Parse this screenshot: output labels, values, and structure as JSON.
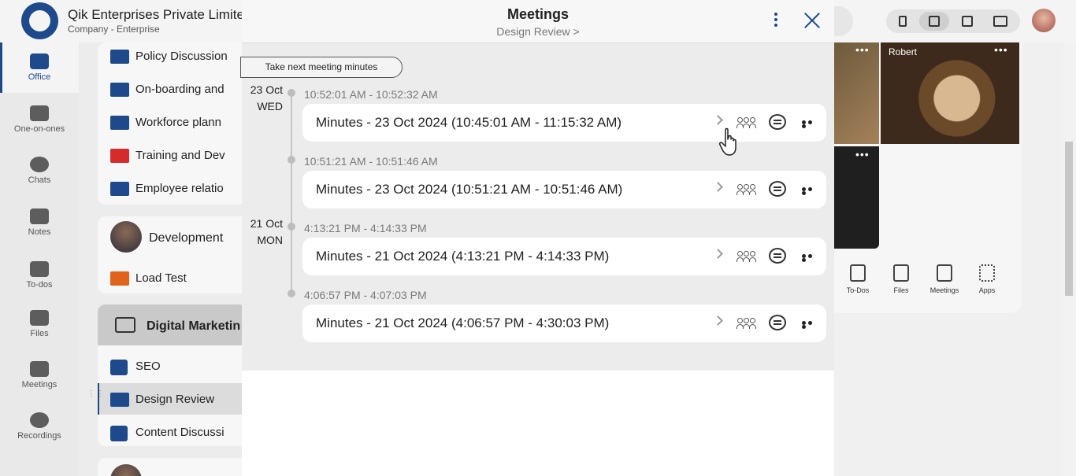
{
  "app": {
    "company_name": "Qik Enterprises Private Limited",
    "company_type": "Company - Enterprise"
  },
  "nav": {
    "items": [
      {
        "label": "Office",
        "icon": "briefcase-icon",
        "active": true
      },
      {
        "label": "One-on-ones",
        "icon": "people-icon"
      },
      {
        "label": "Chats",
        "icon": "chat-icon"
      },
      {
        "label": "Notes",
        "icon": "notes-icon"
      },
      {
        "label": "To-dos",
        "icon": "todo-icon"
      },
      {
        "label": "Files",
        "icon": "files-icon"
      },
      {
        "label": "Meetings",
        "icon": "meetings-icon"
      },
      {
        "label": "Recordings",
        "icon": "recordings-icon"
      }
    ]
  },
  "channels": {
    "items_top": [
      {
        "label": "Policy Discussion",
        "color": "#1e4a8c"
      },
      {
        "label": "On-boarding and",
        "color": "#1e4a8c"
      },
      {
        "label": "Workforce plann",
        "color": "#1e4a8c"
      },
      {
        "label": "Training and Dev",
        "color": "#d62b2b"
      },
      {
        "label": "Employee relatio",
        "color": "#1e4a8c"
      }
    ],
    "development": {
      "title": "Development",
      "items": [
        {
          "label": "Load Test",
          "color": "#e0621c"
        }
      ]
    },
    "digital_marketing": {
      "title": "Digital Marketin",
      "items": [
        {
          "label": "SEO",
          "icon": "location-pin-icon"
        },
        {
          "label": "Design Review",
          "color": "#1e4a8c",
          "selected": true
        },
        {
          "label": "Content Discussi",
          "icon": "location-pin-icon"
        }
      ]
    }
  },
  "right_panel": {
    "participant_name": "Robert",
    "tools": [
      "To-Dos",
      "Files",
      "Meetings",
      "Apps"
    ]
  },
  "modal": {
    "title": "Meetings",
    "subtitle": "Design Review >",
    "next_button": "Take next meeting minutes",
    "dates": [
      {
        "day": "23 Oct",
        "weekday": "WED"
      },
      {
        "day": "21 Oct",
        "weekday": "MON"
      }
    ],
    "meetings": [
      {
        "time_range": "10:52:01 AM - 10:52:32 AM",
        "title": "Minutes - 23 Oct 2024 (10:45:01 AM - 11:15:32 AM)"
      },
      {
        "time_range": "10:51:21 AM - 10:51:46 AM",
        "title": "Minutes - 23 Oct 2024 (10:51:21 AM - 10:51:46 AM)"
      },
      {
        "time_range": "4:13:21 PM - 4:14:33 PM",
        "title": "Minutes - 21 Oct 2024 (4:13:21 PM - 4:14:33 PM)"
      },
      {
        "time_range": "4:06:57 PM - 4:07:03 PM",
        "title": "Minutes - 21 Oct 2024 (4:06:57 PM - 4:30:03 PM)"
      }
    ]
  },
  "colors": {
    "brand": "#1e4a8c",
    "accent_red": "#d62b2b",
    "accent_orange": "#e0621c"
  }
}
